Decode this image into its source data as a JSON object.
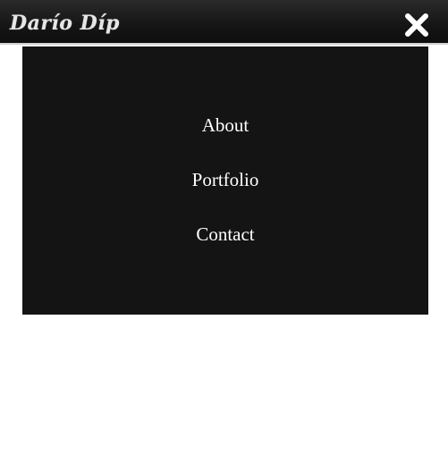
{
  "header": {
    "logo_text": "Darío Díp",
    "close_icon": "close-icon"
  },
  "menu": {
    "items": [
      {
        "label": "About"
      },
      {
        "label": "Portfolio"
      },
      {
        "label": "Contact"
      }
    ]
  },
  "colors": {
    "header_bg": "#151515",
    "menu_bg": "#141414",
    "menu_text": "#ffffff",
    "page_bg": "#ffffff"
  }
}
